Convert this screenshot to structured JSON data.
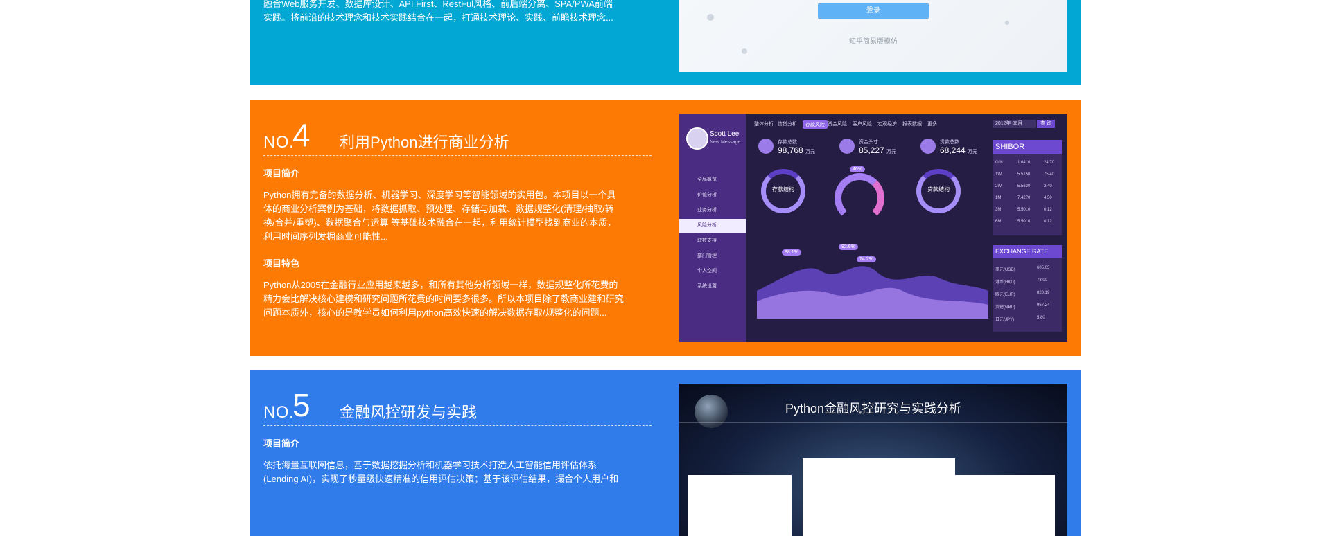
{
  "card3": {
    "text_lines": [
      "融合Web服务开发、数据库设计、API First、RestFul风格、前后端分离、SPA/PWA前端",
      "实践。将前沿的技术理念和技术实践结合在一起，打通技术理论、实践、前瞻技术理念..."
    ],
    "screenshot": {
      "button_label": "登录",
      "caption": "知乎简易版模仿"
    }
  },
  "card4": {
    "no_prefix": "NO.",
    "no_number": "4",
    "title": "利用Python进行商业分析",
    "intro_label": "项目简介",
    "intro_lines": [
      "Python拥有完备的数据分析、机器学习、深度学习等智能领域的实用包。本项目以一个具",
      "体的商业分析案例为基础，将数据抓取、预处理、存储与加载、数据规整化(清理/抽取/转",
      "换/合并/重塑)、数据聚合与运算 等基础技术融合在一起，利用统计模型找到商业的本质，",
      "利用时间序列发掘商业可能性..."
    ],
    "feature_label": "项目特色",
    "feature_lines": [
      "Python从2005在金融行业应用越来越多，和所有其他分析领域一样，数据规整化所花费的",
      "精力会比解决核心建模和研究问题所花费的时间要多很多。所以本项目除了教商业建和研究",
      "问题本质外，核心的是教学员如何利用python高效快速的解决数据存取/规整化的问题..."
    ],
    "screenshot": {
      "user_name": "Scott Lee",
      "user_sub": "New Message",
      "menu": [
        "全局概览",
        "价值分析",
        "业务分析",
        "风险分析",
        "取数支持",
        "部门管理",
        "个人空间",
        "系统设置"
      ],
      "active_menu_index": 3,
      "tabs": [
        "整体分析",
        "信贷分析",
        "存款风险",
        "资金风险",
        "客户风险",
        "宏观经济",
        "报表数据",
        "更多"
      ],
      "active_tab_index": 2,
      "date_label": "2012年 06月",
      "query_label": "查 询",
      "stats": [
        {
          "label": "存款总数",
          "value": "98,768",
          "unit": "万元"
        },
        {
          "label": "资金头寸",
          "value": "85,227",
          "unit": "万元"
        },
        {
          "label": "贷款总数",
          "value": "68,244",
          "unit": "万元"
        }
      ],
      "rings": [
        "存款结构",
        "贷款结构"
      ],
      "gauge_value": "46%",
      "peaks": [
        "88.1%",
        "92.6%",
        "74.2%"
      ],
      "shibor_title": "SHIBOR",
      "shibor_rows": [
        [
          "O/N",
          "1.6410",
          "24.70"
        ],
        [
          "1W",
          "5.5150",
          "75.40"
        ],
        [
          "2W",
          "5.5620",
          "2.40"
        ],
        [
          "1M",
          "7.4270",
          "4.50"
        ],
        [
          "3M",
          "5.5010",
          "0.12"
        ],
        [
          "6M",
          "5.5010",
          "0.12"
        ]
      ],
      "xrate_title": "EXCHANGE RATE",
      "xrate_rows": [
        [
          "美元(USD)",
          "605.05"
        ],
        [
          "港币(HKD)",
          "78.00"
        ],
        [
          "欧元(EUR)",
          "820.19"
        ],
        [
          "英镑(GBP)",
          "957.24"
        ],
        [
          "日元(JPY)",
          "5.80"
        ]
      ]
    }
  },
  "card5": {
    "no_prefix": "NO.",
    "no_number": "5",
    "title": "金融风控研发与实践",
    "intro_label": "项目简介",
    "intro_lines": [
      "依托海量互联网信息，基于数据挖掘分析和机器学习技术打造人工智能信用评估体系",
      "(Lending AI)，实现了秒量级快速精准的信用评估决策；基于该评估结果，撮合个人用户和"
    ],
    "screenshot": {
      "title": "Python金融风控研究与实践分析"
    }
  },
  "colors": {
    "card3_bg": "#02a7d3",
    "card4_bg": "#fd7b05",
    "card5_bg": "#2f7cea",
    "dashboard_accent": "#6d49d1"
  }
}
